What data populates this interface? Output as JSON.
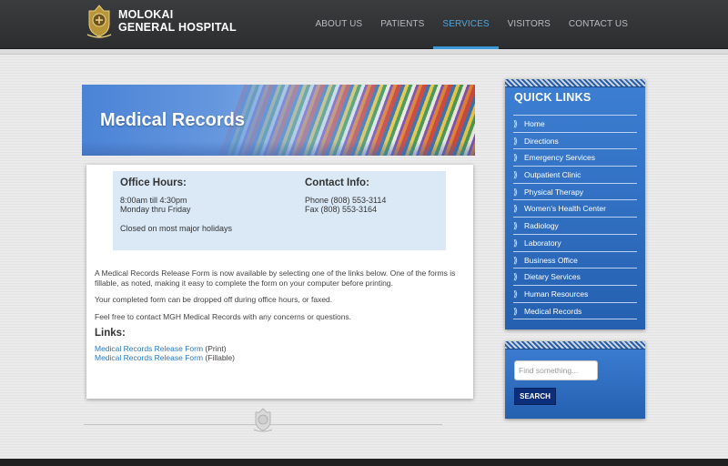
{
  "site": {
    "name_line1": "MOLOKAI",
    "name_line2": "GENERAL HOSPITAL"
  },
  "nav": {
    "items": [
      {
        "label": "ABOUT US"
      },
      {
        "label": "PATIENTS"
      },
      {
        "label": "SERVICES"
      },
      {
        "label": "VISITORS"
      },
      {
        "label": "CONTACT US"
      }
    ],
    "active": "SERVICES"
  },
  "banner": {
    "title": "Medical Records"
  },
  "office": {
    "hours_title": "Office Hours:",
    "hours_line1": "8:00am till 4:30pm",
    "hours_line2": "Monday thru Friday",
    "closed": "Closed on most major holidays",
    "contact_title": "Contact Info:",
    "phone": "Phone (808) 553-3114",
    "fax": "Fax (808) 553-3164"
  },
  "body": {
    "para1": "A Medical Records Release Form is now available by selecting one of the links below. One of the forms is fillable, as noted, making it easy to complete the form on your computer before printing.",
    "para2": "Your completed form can be dropped off during office hours, or faxed.",
    "para3": "Feel free to contact MGH Medical Records with any concerns or questions.",
    "links_title": "Links:",
    "links": [
      {
        "label": "Medical Records Release Form",
        "note": "(Print)"
      },
      {
        "label": "Medical Records Release Form",
        "note": "(Fillable)"
      }
    ]
  },
  "quick_links": {
    "title": "QUICK LINKS",
    "items": [
      "Home",
      "Directions",
      "Emergency Services",
      "Outpatient Clinic",
      "Physical Therapy",
      "Women’s Health Center",
      "Radiology",
      "Laboratory",
      "Business Office",
      "Dietary Services",
      "Human Resources",
      "Medical Records"
    ]
  },
  "search": {
    "placeholder": "Find something...",
    "button_label": "SEARCH"
  },
  "colors": {
    "accent": "#3b9ad6",
    "sidebar_blue": "#2b6cc4",
    "link": "#2879c4"
  }
}
